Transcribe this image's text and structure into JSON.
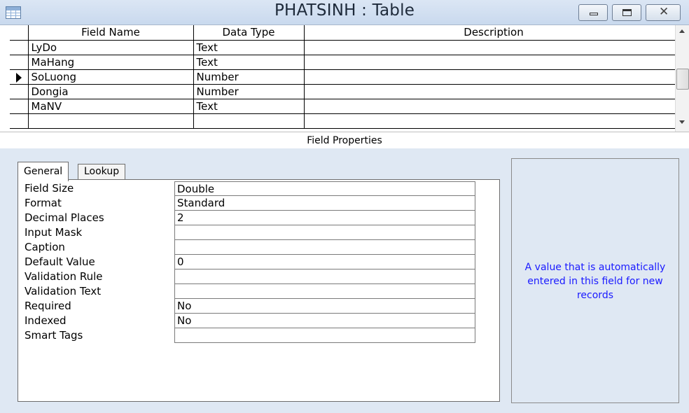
{
  "window": {
    "title": "PHATSINH : Table",
    "controls": [
      "minimize",
      "maximize",
      "close"
    ],
    "close_glyph": "✕"
  },
  "grid": {
    "headers": {
      "field_name": "Field Name",
      "data_type": "Data Type",
      "description": "Description"
    },
    "rows": [
      {
        "field_name": "LyDo",
        "data_type": "Text",
        "description": ""
      },
      {
        "field_name": "MaHang",
        "data_type": "Text",
        "description": ""
      },
      {
        "field_name": "SoLuong",
        "data_type": "Number",
        "description": ""
      },
      {
        "field_name": "Dongia",
        "data_type": "Number",
        "description": ""
      },
      {
        "field_name": "MaNV",
        "data_type": "Text",
        "description": ""
      },
      {
        "field_name": "",
        "data_type": "",
        "description": ""
      }
    ],
    "selected_row": 2
  },
  "field_properties": {
    "header": "Field Properties",
    "tabs": {
      "general": "General",
      "lookup": "Lookup"
    },
    "active_tab": "General",
    "properties": [
      {
        "label": "Field Size",
        "value": "Double"
      },
      {
        "label": "Format",
        "value": "Standard"
      },
      {
        "label": "Decimal Places",
        "value": "2"
      },
      {
        "label": "Input Mask",
        "value": ""
      },
      {
        "label": "Caption",
        "value": ""
      },
      {
        "label": "Default Value",
        "value": "0"
      },
      {
        "label": "Validation Rule",
        "value": ""
      },
      {
        "label": "Validation Text",
        "value": ""
      },
      {
        "label": "Required",
        "value": "No"
      },
      {
        "label": "Indexed",
        "value": "No"
      },
      {
        "label": "Smart Tags",
        "value": ""
      }
    ],
    "help_text": "A value that is automatically entered in this field for new records"
  },
  "colors": {
    "titlebar": "#c9d9ee",
    "pane_background": "#dfe8f3",
    "help_text": "#1a1aff"
  }
}
